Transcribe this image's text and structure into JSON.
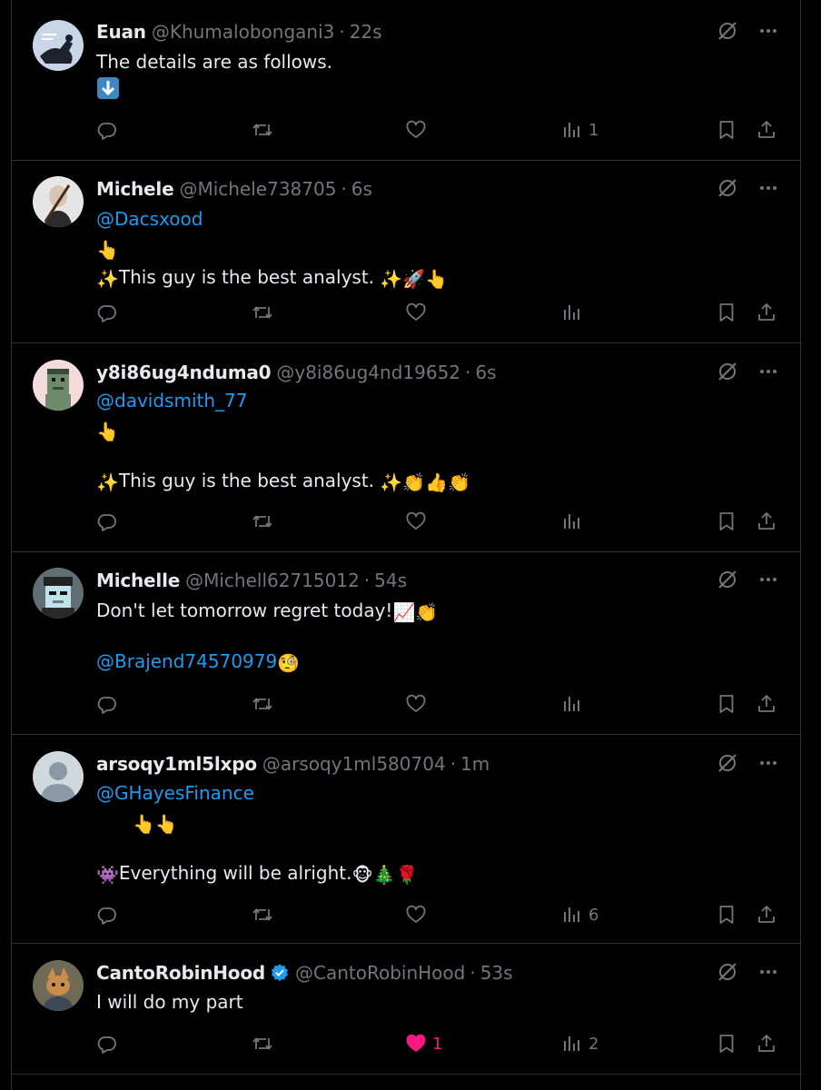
{
  "tweets": [
    {
      "name": "Euan",
      "handle": "@Khumalobongani3",
      "time": "22s",
      "lines": [
        {
          "text": "The details are as follows.",
          "type": "text"
        },
        {
          "text": "",
          "type": "emoji",
          "emoji": [
            "down-arrow-emoji"
          ]
        }
      ],
      "views": "1",
      "likes": ""
    },
    {
      "name": "Michele",
      "handle": "@Michele738705",
      "time": "6s",
      "mention": "@Dacsxood",
      "text": "This guy is the best analyst.",
      "views": "",
      "likes": ""
    },
    {
      "name": "y8i86ug4nduma0",
      "handle": "@y8i86ug4nd19652",
      "time": "6s",
      "mention": "@davidsmith_77",
      "text": "This guy is the best analyst.",
      "views": "",
      "likes": ""
    },
    {
      "name": "Michelle",
      "handle": "@Michell62715012",
      "time": "54s",
      "text": "Don't let tomorrow regret today!",
      "mention": "@Brajend74570979",
      "views": "",
      "likes": ""
    },
    {
      "name": "arsoqy1ml5lxpo",
      "handle": "@arsoqy1ml580704",
      "time": "1m",
      "mention": "@GHayesFinance",
      "text": "Everything will be alright.",
      "views": "6",
      "likes": ""
    },
    {
      "name": "CantoRobinHood",
      "handle": "@CantoRobinHood",
      "time": "53s",
      "verified": true,
      "text": "I will do my part",
      "views": "2",
      "likes": "1",
      "liked": true
    }
  ],
  "icons": [
    "avatar",
    "reply-icon",
    "repost-icon",
    "like-icon",
    "views-icon",
    "bookmark-icon",
    "share-icon",
    "grok-icon",
    "more-icon",
    "verified-badge-icon"
  ],
  "colors": {
    "background": "#000000",
    "text": "#e7e9ea",
    "secondary": "#71767b",
    "mention": "#1d9bf0",
    "like": "#f91880",
    "verified": "#1d9bf0",
    "border": "#2f3336"
  }
}
